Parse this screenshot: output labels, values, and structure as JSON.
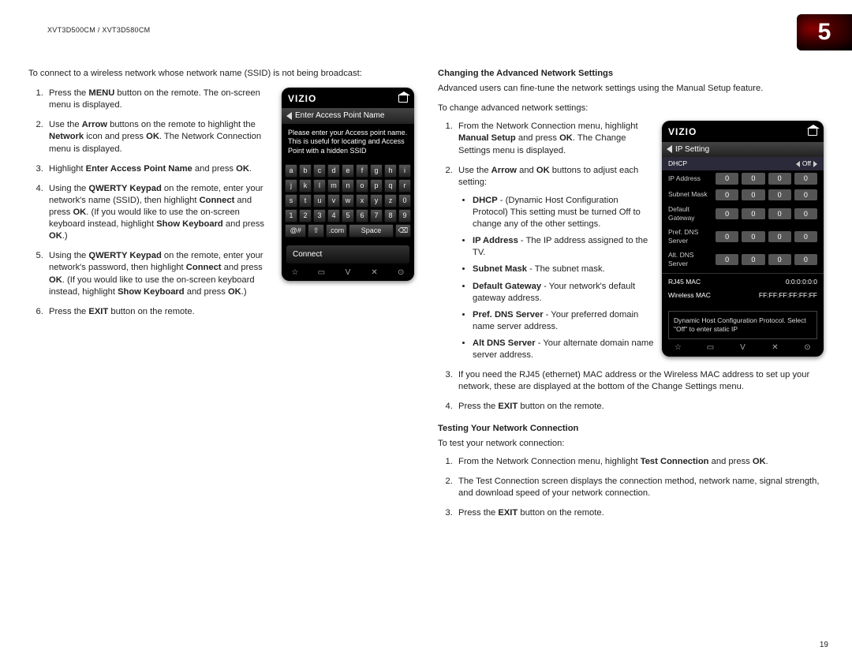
{
  "model_header": "XVT3D500CM / XVT3D580CM",
  "page_badge": "5",
  "page_number": "19",
  "left": {
    "intro": "To connect to a wireless network whose network name (SSID) is not being broadcast:",
    "steps": {
      "s1a": "Press the ",
      "s1b": "MENU",
      "s1c": " button on the remote. The on-screen menu is displayed.",
      "s2a": "Use the ",
      "s2b": "Arrow",
      "s2c": " buttons on the remote to highlight the ",
      "s2d": "Network",
      "s2e": " icon and press ",
      "s2f": "OK",
      "s2g": ". The Network Connection menu is displayed.",
      "s3a": "Highlight ",
      "s3b": "Enter Access Point Name",
      "s3c": " and press ",
      "s3d": "OK",
      "s3e": ".",
      "s4a": "Using the ",
      "s4b": "QWERTY Keypad",
      "s4c": " on the remote, enter your network's name (SSID), then highlight ",
      "s4d": "Connect",
      "s4e": " and press ",
      "s4f": "OK",
      "s4g": ". (If you would like to use the on-screen keyboard instead, highlight ",
      "s4h": "Show Keyboard",
      "s4i": " and press ",
      "s4j": "OK",
      "s4k": ".)",
      "s5a": "Using the ",
      "s5b": "QWERTY Keypad",
      "s5c": " on the remote, enter your network's password, then highlight ",
      "s5d": "Connect",
      "s5e": " and press ",
      "s5f": "OK",
      "s5g": ". (If you would like to use the on-screen keyboard instead, highlight ",
      "s5h": "Show Keyboard",
      "s5i": " and press ",
      "s5j": "OK",
      "s5k": ".)",
      "s6a": "Press the ",
      "s6b": "EXIT",
      "s6c": " button on the remote."
    }
  },
  "device1": {
    "brand": "VIZIO",
    "title": "Enter Access Point Name",
    "desc": "Please enter your Access point name. This is useful for locating and Access Point with a hidden SSID",
    "rows": [
      [
        "a",
        "b",
        "c",
        "d",
        "e",
        "f",
        "g",
        "h",
        "i"
      ],
      [
        "j",
        "k",
        "l",
        "m",
        "n",
        "o",
        "p",
        "q",
        "r"
      ],
      [
        "s",
        "t",
        "u",
        "v",
        "w",
        "x",
        "y",
        "z",
        "0"
      ],
      [
        "1",
        "2",
        "3",
        "4",
        "5",
        "6",
        "7",
        "8",
        "9"
      ]
    ],
    "row5": {
      "k1": "@#",
      "k2": "⇧",
      "k3": ".com",
      "k4": "Space",
      "k5": "⌫"
    },
    "connect": "Connect",
    "foot": {
      "i1": "☆",
      "i2": "▭",
      "i3": "V",
      "i4": "✕",
      "i5": "⊙"
    }
  },
  "right": {
    "h1": "Changing the Advanced Network Settings",
    "p1": "Advanced users can fine-tune the network settings using the Manual Setup feature.",
    "p2": "To change advanced network settings:",
    "r1a": "From the Network Connection menu, highlight ",
    "r1b": "Manual Setup",
    "r1c": " and press ",
    "r1d": "OK",
    "r1e": ". The Change Settings menu is displayed.",
    "r2a": "Use the ",
    "r2b": "Arrow",
    "r2c": " and ",
    "r2d": "OK",
    "r2e": " buttons to adjust each setting:",
    "b_dhcp_a": "DHCP",
    "b_dhcp_b": " - (Dynamic Host Configuration Protocol) This setting must be turned Off to change any of the other settings.",
    "b_ip_a": "IP Address",
    "b_ip_b": " - The IP address assigned to the TV.",
    "b_sm_a": "Subnet Mask",
    "b_sm_b": " - The subnet mask.",
    "b_dg_a": "Default Gateway",
    "b_dg_b": " - Your network's default gateway address.",
    "b_pd_a": "Pref. DNS Server",
    "b_pd_b": " - Your preferred domain name server address.",
    "b_ad_a": "Alt DNS Server",
    "b_ad_b": " - Your alternate domain name server address.",
    "r3": "If you need the RJ45 (ethernet) MAC address or the Wireless MAC address to set up your network, these are displayed at the bottom of the Change Settings menu.",
    "r4a": "Press the ",
    "r4b": "EXIT",
    "r4c": " button on the remote.",
    "h2": "Testing Your Network Connection",
    "p3": "To test your network connection:",
    "t1a": "From the Network Connection menu, highlight ",
    "t1b": "Test Connection",
    "t1c": " and press ",
    "t1d": "OK",
    "t1e": ".",
    "t2": "The Test Connection screen displays the connection method, network name, signal strength, and download speed of your network connection.",
    "t3a": "Press the ",
    "t3b": "EXIT",
    "t3c": " button on the remote."
  },
  "device2": {
    "brand": "VIZIO",
    "title": "IP Setting",
    "dhcp_label": "DHCP",
    "dhcp_val": "Off",
    "rows": [
      {
        "label": "IP Address",
        "o": [
          "0",
          "0",
          "0",
          "0"
        ]
      },
      {
        "label": "Subnet Mask",
        "o": [
          "0",
          "0",
          "0",
          "0"
        ]
      },
      {
        "label": "Default Gateway",
        "o": [
          "0",
          "0",
          "0",
          "0"
        ]
      },
      {
        "label": "Pref. DNS Server",
        "o": [
          "0",
          "0",
          "0",
          "0"
        ]
      },
      {
        "label": "Alt. DNS Server",
        "o": [
          "0",
          "0",
          "0",
          "0"
        ]
      }
    ],
    "rj45_label": "RJ45 MAC",
    "rj45_val": "0:0:0:0:0:0",
    "wmac_label": "Wireless MAC",
    "wmac_val": "FF:FF:FF:FF:FF:FF",
    "help": "Dynamic Host Configuration Protocol. Select \"Off\" to enter static IP",
    "foot": {
      "i1": "☆",
      "i2": "▭",
      "i3": "V",
      "i4": "✕",
      "i5": "⊙"
    }
  }
}
